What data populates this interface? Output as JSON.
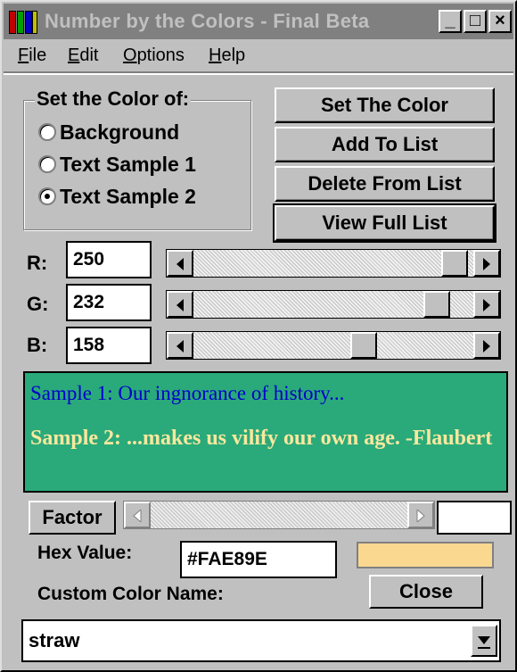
{
  "window": {
    "title": "Number by the Colors - Final Beta",
    "controls": {
      "minimize": "_",
      "maximize": "□",
      "close": "×"
    }
  },
  "menu": {
    "items": [
      {
        "label": "File",
        "accel": "F",
        "rest": "ile"
      },
      {
        "label": "Edit",
        "accel": "E",
        "rest": "dit"
      },
      {
        "label": "Options",
        "accel": "O",
        "rest": "ptions"
      },
      {
        "label": "Help",
        "accel": "H",
        "rest": "elp"
      }
    ]
  },
  "color_target": {
    "group_label": "Set the Color of:",
    "options": [
      {
        "label": "Background",
        "selected": false
      },
      {
        "label": "Text Sample 1",
        "selected": false
      },
      {
        "label": "Text Sample 2",
        "selected": true
      }
    ]
  },
  "buttons": {
    "set_color": "Set The Color",
    "add_to_list": "Add To List",
    "delete_from_list": "Delete From List",
    "view_full_list": "View Full List",
    "factor": "Factor",
    "close": "Close"
  },
  "rgb": {
    "r": {
      "label": "R:",
      "value": "250",
      "level": 250,
      "max": 255
    },
    "g": {
      "label": "G:",
      "value": "232",
      "level": 232,
      "max": 255
    },
    "b": {
      "label": "B:",
      "value": "158",
      "level": 158,
      "max": 255
    }
  },
  "sample": {
    "background_color": "#2AAA7A",
    "sample1_text": "Sample 1: Our ingnorance of history...",
    "sample1_color": "#0000CC",
    "sample2_text": "Sample 2: ...makes us vilify our own age.    -Flaubert",
    "sample2_color": "#FAE89E"
  },
  "factor": {
    "value": ""
  },
  "hex": {
    "label": "Hex Value:",
    "value": "#FAE89E",
    "swatch_color": "#FAD890"
  },
  "custom_name": {
    "label": "Custom Color Name:",
    "value": "straw"
  },
  "icons": {
    "app": "crayons-icon",
    "scroll_left": "arrow-left-icon",
    "scroll_right": "arrow-right-icon",
    "dropdown": "chevron-down-icon"
  }
}
